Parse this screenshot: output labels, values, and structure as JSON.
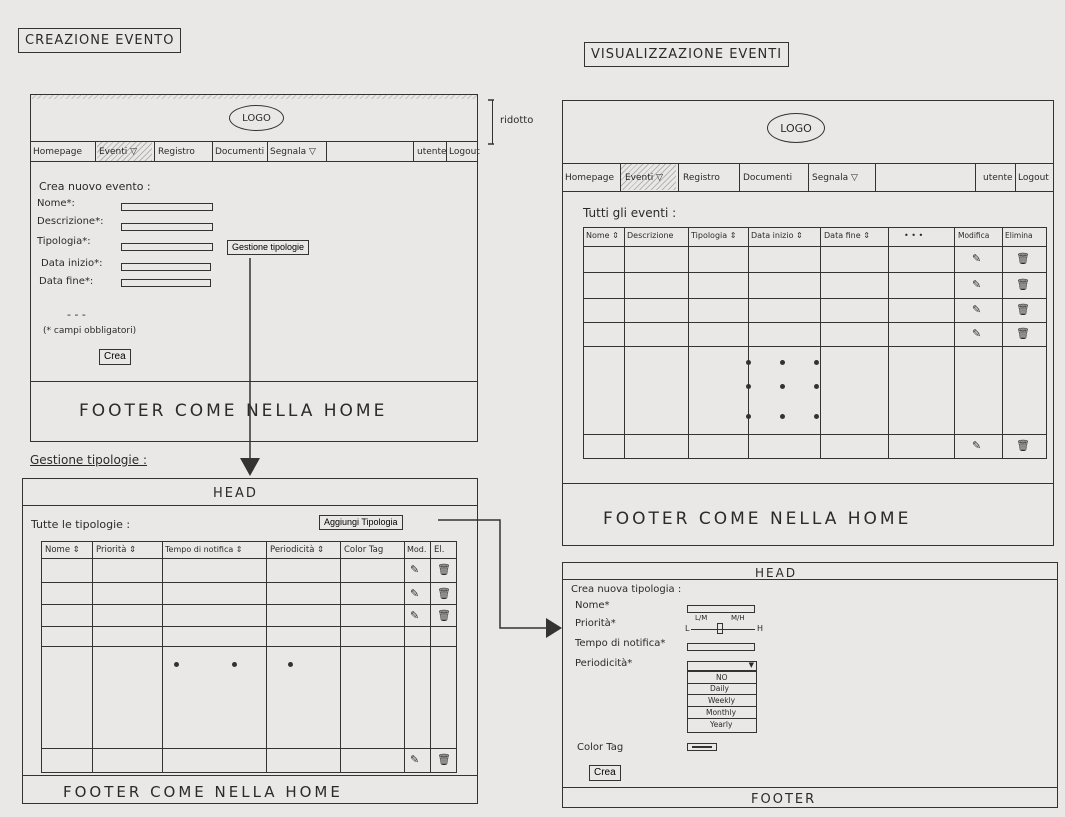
{
  "sketch": {
    "creazione": {
      "title": "CREAZIONE EVENTO",
      "logo": "LOGO",
      "side_note": "ridotto",
      "nav": [
        "Homepage",
        "Eventi ▽",
        "Registro",
        "Documenti",
        "Segnala ▽"
      ],
      "nav_right": [
        "utente",
        "Logout"
      ],
      "form_heading": "Crea nuovo evento :",
      "fields": [
        "Nome*:",
        "Descrizione*:",
        "Tipologia*:",
        "Data inizio*:",
        "Data fine*:"
      ],
      "gestione_button": "Gestione tipologie",
      "ellipsis": "- - -",
      "required_note": "(* campi obbligatori)",
      "create_button": "Crea",
      "footer": "FOOTER COME NELLA HOME"
    },
    "gestione": {
      "label": "Gestione tipologie :",
      "head": "HEAD",
      "all_label": "Tutte le tipologie :",
      "add_button": "Aggiungi Tipologia",
      "columns": [
        "Nome ⇕",
        "Priorità ⇕",
        "Tempo di notifica ⇕",
        "Periodicità ⇕",
        "Color Tag",
        "Mod.",
        "El."
      ],
      "edit_icon": "pencil-icon",
      "delete_icon": "trash-icon",
      "footer": "FOOTER COME NELLA HOME"
    },
    "visualizzazione": {
      "title": "VISUALIZZAZIONE EVENTI",
      "logo": "LOGO",
      "nav": [
        "Homepage",
        "Eventi ▽",
        "Registro",
        "Documenti",
        "Segnala ▽"
      ],
      "nav_right": [
        "utente",
        "Logout"
      ],
      "all_label": "Tutti gli eventi :",
      "columns": [
        "Nome ⇕",
        "Descrizione",
        "Tipologia ⇕",
        "Data inizio ⇕",
        "Data fine ⇕",
        "• • •",
        "Modifica",
        "Elimina"
      ],
      "footer": "FOOTER COME NELLA HOME"
    },
    "nuova_tipologia": {
      "head": "HEAD",
      "heading": "Crea nuova tipologia :",
      "fields": [
        "Nome*",
        "Priorità*",
        "Tempo di notifica*",
        "Periodicità*"
      ],
      "slider_labels": [
        "L/M",
        "M/H"
      ],
      "slider_ends": [
        "L",
        "H"
      ],
      "periodicity_options": [
        "NO",
        "Daily",
        "Weekly",
        "Monthly",
        "Yearly"
      ],
      "color_tag_label": "Color Tag",
      "create_button": "Crea",
      "footer": "FOOTER"
    }
  }
}
